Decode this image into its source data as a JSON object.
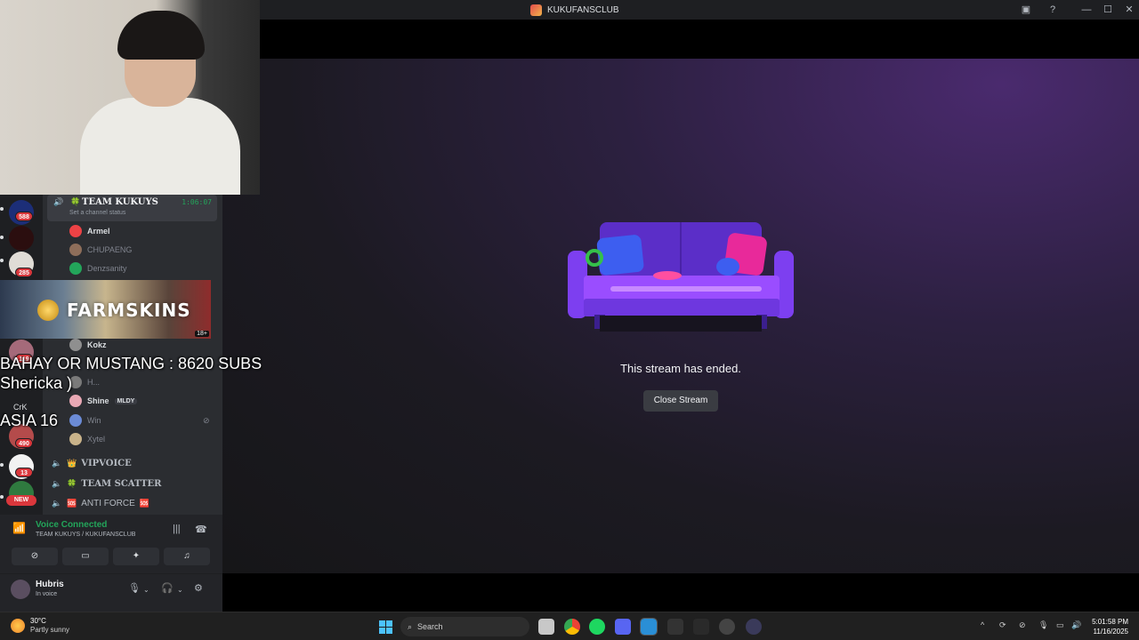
{
  "window": {
    "title": "KUKUFANSCLUB",
    "controls": [
      "inbox-icon",
      "help-icon",
      "minimize-icon",
      "maximize-icon",
      "close-icon"
    ]
  },
  "servers": [
    {
      "name": "TGL",
      "badge": "588",
      "color": "#2a4ad8"
    },
    {
      "name": "TGL",
      "badge": "",
      "color": "#d8232a"
    },
    {
      "name": "server-3",
      "badge": "285",
      "color": "#e0dcd6"
    },
    {
      "name": "server-4",
      "badge": "119",
      "color": "#a56a7a"
    },
    {
      "name": "CrK",
      "badge": "",
      "color": "#1e1f22"
    },
    {
      "name": "server-6",
      "badge": "490",
      "color": "#b44b4b"
    },
    {
      "name": "server-7",
      "badge": "13",
      "color": "#f2f2f2"
    },
    {
      "name": "server-8",
      "badge": "NEW",
      "color": "#2f7a3f"
    }
  ],
  "channels": {
    "active": {
      "name": "TEAM KUKUYS",
      "emoji": "🍀",
      "timer": "1:06:07",
      "status_placeholder": "Set a channel status"
    },
    "members": [
      {
        "name": "Armel",
        "dim": false,
        "color": "#ed4245"
      },
      {
        "name": "CHUPAENG",
        "dim": true,
        "color": "#8e6e5a"
      },
      {
        "name": "Denzsanity",
        "dim": true,
        "color": "#23a55a"
      },
      {
        "name": "Kokz",
        "dim": false,
        "color": "#8f8f8f"
      },
      {
        "name": "H...",
        "dim": true,
        "color": "#7a7a7a"
      },
      {
        "name": "Shine",
        "dim": false,
        "color": "#e9a8b4",
        "tag": "MLDY"
      },
      {
        "name": "Win",
        "dim": true,
        "color": "#6b8bd6"
      },
      {
        "name": "Xytel",
        "dim": true,
        "color": "#c9b38a"
      }
    ],
    "other": [
      {
        "name": "VIPVOICE",
        "emoji": "👑"
      },
      {
        "name": "TEAM SCATTER",
        "emoji": "🍀"
      },
      {
        "name": "ANTI FORCE",
        "emoji": "🆘"
      }
    ]
  },
  "ad": {
    "text": "FARMSKINS",
    "age": "18+"
  },
  "overlay": {
    "line1": "BAHAY OR MUSTANG : 8620 SUBS",
    "line2": "Shericka )",
    "line3": "ASIA 16",
    "crk": "CrK"
  },
  "voice": {
    "status": "Voice Connected",
    "location": "TEAM KUKUYS / KUKUFANSCLUB",
    "buttons": [
      "camera-off-icon",
      "screen-share-icon",
      "activities-icon",
      "soundboard-icon"
    ]
  },
  "user": {
    "name": "Hubris",
    "status": "In voice"
  },
  "stream": {
    "ended_message": "This stream has ended.",
    "close_label": "Close Stream"
  },
  "taskbar": {
    "temperature": "30°C",
    "weather": "Partly sunny",
    "search_placeholder": "Search",
    "time": "5:01:58 PM",
    "date": "11/16/2025"
  }
}
